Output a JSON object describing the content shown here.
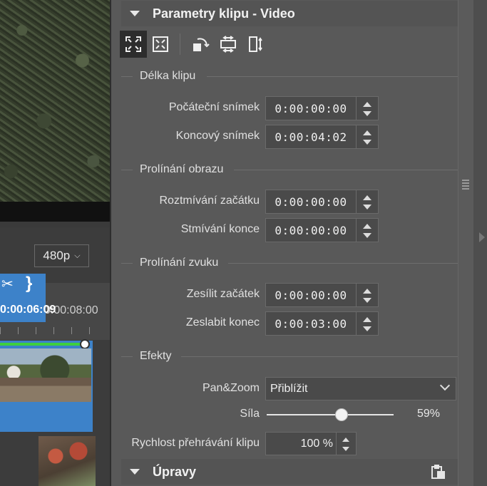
{
  "preview": {
    "resolution": "480p"
  },
  "timeline": {
    "current_time": "0:00:06:09",
    "ruler_time": "0:00:08:00"
  },
  "panel": {
    "title": "Parametry klipu - Video",
    "toolbar_icons": [
      "fit-frame-icon",
      "fill-frame-icon",
      "rotate-icon",
      "flip-horizontal-icon",
      "flip-vertical-icon"
    ],
    "clip_length": {
      "title": "Délka klipu",
      "start_label": "Počáteční snímek",
      "start_value": "0:00:00:00",
      "end_label": "Koncový snímek",
      "end_value": "0:00:04:02"
    },
    "video_fade": {
      "title": "Prolínání obrazu",
      "fade_in_label": "Roztmívání začátku",
      "fade_in_value": "0:00:00:00",
      "fade_out_label": "Stmívání konce",
      "fade_out_value": "0:00:00:00"
    },
    "audio_fade": {
      "title": "Prolínání zvuku",
      "fade_in_label": "Zesílit začátek",
      "fade_in_value": "0:00:00:00",
      "fade_out_label": "Zeslabit konec",
      "fade_out_value": "0:00:03:00"
    },
    "effects": {
      "title": "Efekty",
      "panzoom_label": "Pan&Zoom",
      "panzoom_value": "Přiblížit",
      "strength_label": "Síla",
      "strength_text": "59%",
      "strength_fraction": 0.59,
      "speed_label": "Rychlost přehrávání klipu",
      "speed_value": "100 %"
    },
    "edits_title": "Úpravy"
  },
  "colors": {
    "accent": "#3d82c9",
    "panel_bg": "#595959",
    "green_marker": "#3ecf3e"
  }
}
